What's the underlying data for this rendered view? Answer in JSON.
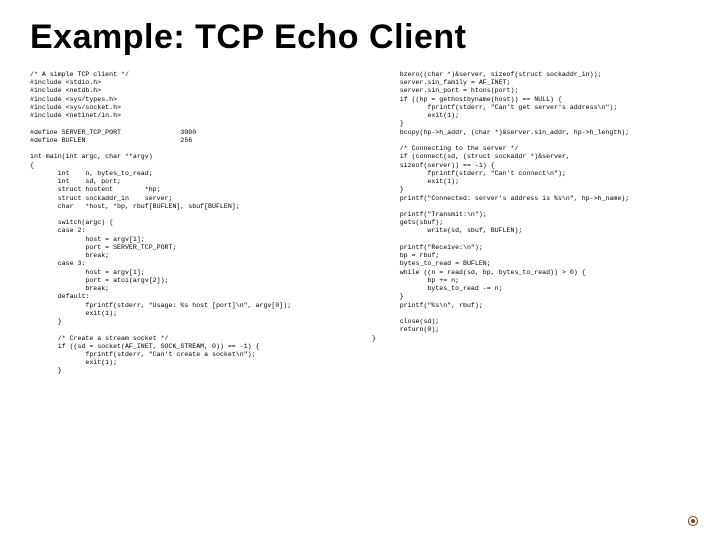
{
  "title": "Example: TCP Echo Client",
  "code_left": "/* A simple TCP client */\n#include <stdio.h>\n#include <netdb.h>\n#include <sys/types.h>\n#include <sys/socket.h>\n#include <netinet/in.h>\n\n#define SERVER_TCP_PORT               3000\n#define BUFLEN                        256\n\nint main(int argc, char **argv)\n{\n       int    n, bytes_to_read;\n       int    sd, port;\n       struct hostent        *hp;\n       struct sockaddr_in    server;\n       char   *host, *bp, rbuf[BUFLEN], sbuf[BUFLEN];\n\n       switch(argc) {\n       case 2:\n              host = argv[1];\n              port = SERVER_TCP_PORT;\n              break;\n       case 3:\n              host = argv[1];\n              port = atoi(argv[2]);\n              break;\n       default:\n              fprintf(stderr, \"Usage: %s host [port]\\n\", argv[0]);\n              exit(1);\n       }\n\n       /* Create a stream socket */\n       if ((sd = socket(AF_INET, SOCK_STREAM, 0)) == -1) {\n              fprintf(stderr, \"Can't create a socket\\n\");\n              exit(1);\n       }",
  "code_right": "       bzero((char *)&server, sizeof(struct sockaddr_in));\n       server.sin_family = AF_INET;\n       server.sin_port = htons(port);\n       if ((hp = gethostbyname(host)) == NULL) {\n              fprintf(stderr, \"Can't get server's address\\n\");\n              exit(1);\n       }\n       bcopy(hp->h_addr, (char *)&server.sin_addr, hp->h_length);\n\n       /* Connecting to the server */\n       if (connect(sd, (struct sockaddr *)&server,\n       sizeof(server)) == -1) {\n              fprintf(stderr, \"Can't connect\\n\");\n              exit(1);\n       }\n       printf(\"Connected: server's address is %s\\n\", hp->h_name);\n\n       printf(\"Transmit:\\n\");\n       gets(sbuf);\n              write(sd, sbuf, BUFLEN);\n\n       printf(\"Receive:\\n\");\n       bp = rbuf;\n       bytes_to_read = BUFLEN;\n       while ((n = read(sd, bp, bytes_to_read)) > 0) {\n              bp += n;\n              bytes_to_read -= n;\n       }\n       printf(\"%s\\n\", rbuf);\n\n       close(sd);\n       return(0);\n}"
}
